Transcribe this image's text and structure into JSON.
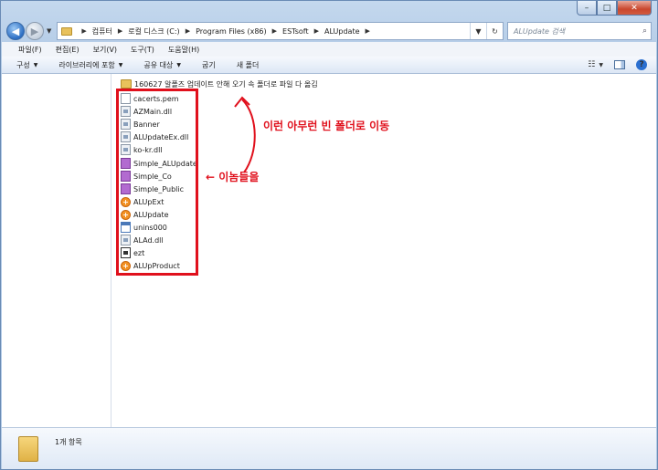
{
  "address": {
    "crumbs": [
      "컴퓨터",
      "로컬 디스크 (C:)",
      "Program Files (x86)",
      "ESTsoft",
      "ALUpdate"
    ],
    "search_placeholder": "ALUpdate 검색"
  },
  "menu": [
    "파일(F)",
    "편집(E)",
    "보기(V)",
    "도구(T)",
    "도움말(H)"
  ],
  "commands": [
    {
      "label": "구성",
      "dropdown": true
    },
    {
      "label": "라이브러리에 포함",
      "dropdown": true
    },
    {
      "label": "공유 대상",
      "dropdown": true
    },
    {
      "label": "굽기",
      "dropdown": false
    },
    {
      "label": "새 폴더",
      "dropdown": false
    }
  ],
  "files": [
    {
      "name": "160627 알폴즈 업데이트 안해 오기 속 폴더로 파일 다 옮김",
      "icon": "folder"
    },
    {
      "name": "cacerts.pem",
      "icon": "doc"
    },
    {
      "name": "AZMain.dll",
      "icon": "dll"
    },
    {
      "name": "Banner",
      "icon": "dll"
    },
    {
      "name": "ALUpdateEx.dll",
      "icon": "dll"
    },
    {
      "name": "ko-kr.dll",
      "icon": "dll"
    },
    {
      "name": "Simple_ALUpdate",
      "icon": "reg"
    },
    {
      "name": "Simple_Co",
      "icon": "reg"
    },
    {
      "name": "Simple_Public",
      "icon": "reg"
    },
    {
      "name": "ALUpExt",
      "icon": "orange"
    },
    {
      "name": "ALUpdate",
      "icon": "orange"
    },
    {
      "name": "unins000",
      "icon": "app"
    },
    {
      "name": "ALAd.dll",
      "icon": "dll"
    },
    {
      "name": "ezt",
      "icon": "black"
    },
    {
      "name": "ALUpProduct",
      "icon": "orange"
    }
  ],
  "annotations": {
    "move_note": "이런 아무런 빈 폴더로 이동",
    "these_note": "← 이놈들을"
  },
  "details": {
    "count": "1개 항목"
  },
  "colors": {
    "annotation": "#e0101c"
  }
}
